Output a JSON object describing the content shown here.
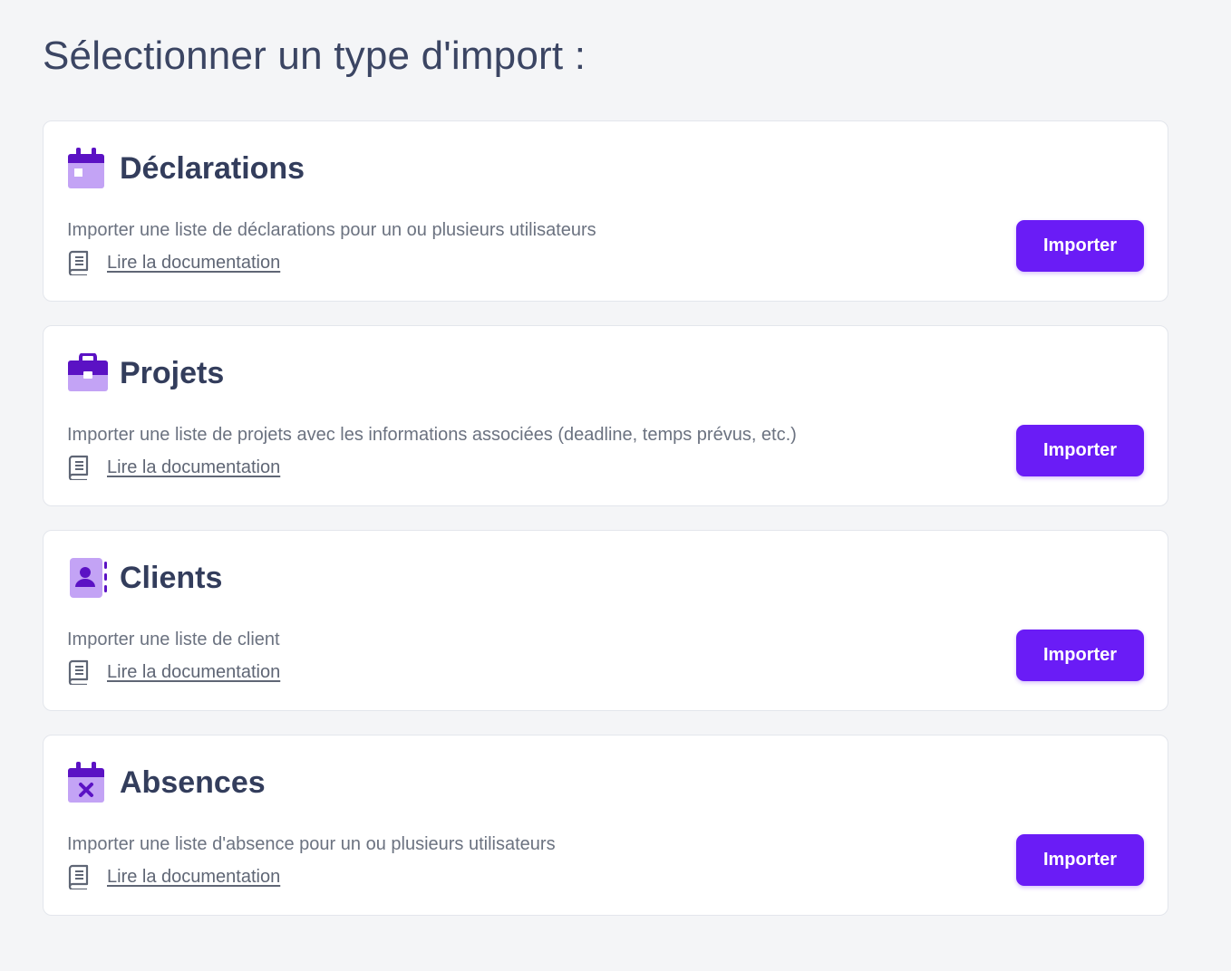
{
  "page": {
    "title": "Sélectionner un type d'import :"
  },
  "colors": {
    "accent": "#6a1cf6",
    "icon_dark": "#5b12c4",
    "icon_light": "#c3a3f5",
    "background": "#f4f5f7",
    "card": "#ffffff"
  },
  "cards": [
    {
      "title": "Déclarations",
      "icon": "calendar-icon",
      "description": "Importer une liste de déclarations pour un ou plusieurs utilisateurs",
      "doc_link": "Lire la documentation",
      "doc_icon": "book-icon",
      "button": "Importer"
    },
    {
      "title": "Projets",
      "icon": "briefcase-icon",
      "description": "Importer une liste de projets avec les informations associées (deadline, temps prévus, etc.)",
      "doc_link": "Lire la documentation",
      "doc_icon": "book-icon",
      "button": "Importer"
    },
    {
      "title": "Clients",
      "icon": "contact-book-icon",
      "description": "Importer une liste de client",
      "doc_link": "Lire la documentation",
      "doc_icon": "book-icon",
      "button": "Importer"
    },
    {
      "title": "Absences",
      "icon": "calendar-x-icon",
      "description": "Importer une liste d'absence pour un ou plusieurs utilisateurs",
      "doc_link": "Lire la documentation",
      "doc_icon": "book-icon",
      "button": "Importer"
    }
  ]
}
